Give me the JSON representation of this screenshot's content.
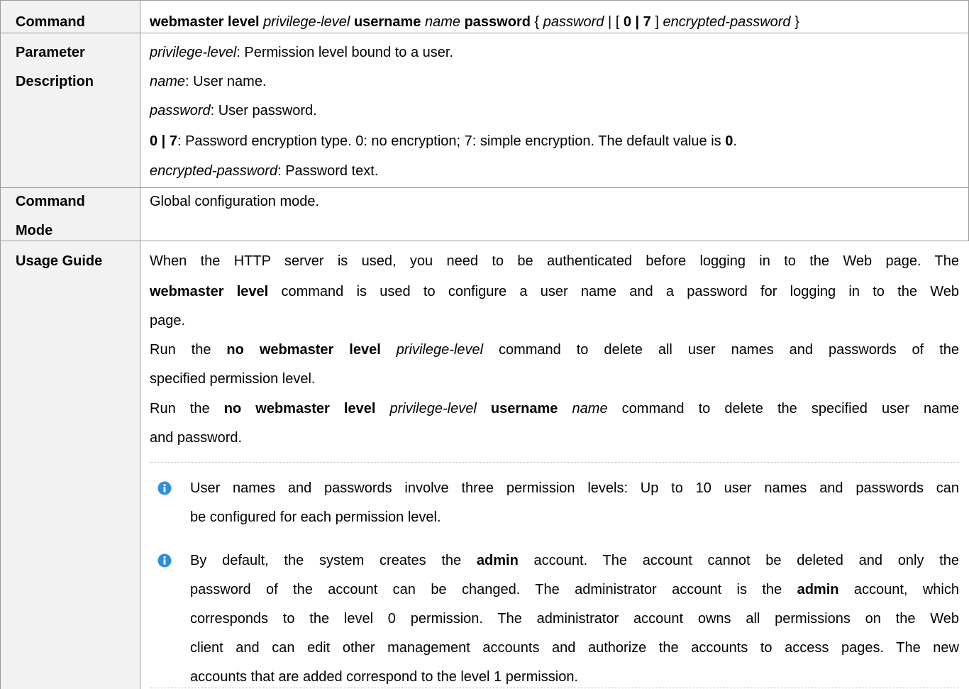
{
  "labels": {
    "command": "Command",
    "param_1": "Parameter",
    "param_2": "Description",
    "mode_1": "Command",
    "mode_2": "Mode",
    "usage": "Usage Guide"
  },
  "command_syntax": {
    "kw1": "webmaster level",
    "a1": "privilege-level",
    "kw2": "username",
    "a2": "name",
    "kw3": "password",
    "p1": "{",
    "a3": "password",
    "p2": "| [",
    "kw4": "0 | 7",
    "p3": "]",
    "a4": "encrypted-password",
    "p4": "}"
  },
  "params": {
    "p1_name": "privilege-level",
    "p1_desc": ": Permission level bound to a user.",
    "p2_name": "name",
    "p2_desc": ": User name.",
    "p3_name": "password",
    "p3_desc": ": User password.",
    "p4_name": "0 | 7",
    "p4_desc": ": Password encryption type. 0: no encryption; 7: simple encryption. The default value is ",
    "p4_default": "0",
    "p4_end": ".",
    "p5_name": "encrypted-password",
    "p5_desc": ": Password text."
  },
  "mode_text": "Global configuration mode.",
  "usage": {
    "l1": "When the HTTP server is used, you need to be authenticated before logging in to the Web page. The",
    "l2_kw": "webmaster level",
    "l2_rest": " command is used to configure a user name and a password for logging in to the Web",
    "l3": "page.",
    "l4_a": "Run the ",
    "l4_kw": "no webmaster level",
    "l4_arg": "privilege-level",
    "l4_rest": " command to delete all user names and passwords of the",
    "l5": "specified permission level.",
    "l6_a": "Run the ",
    "l6_kw": "no webmaster level",
    "l6_arg": "privilege-level",
    "l6_kw2": "username",
    "l6_arg2": "name",
    "l6_rest": " command to delete the specified user name",
    "l7": "and password."
  },
  "notes": {
    "n1_l1": "User names and passwords involve three permission levels: Up to 10 user names and passwords can",
    "n1_l2": "be configured for each permission level.",
    "n2_l1_a": "By default, the system creates the ",
    "n2_l1_kw": "admin",
    "n2_l1_b": " account. The account cannot be deleted and only the",
    "n2_l2_a": "password of the account can be changed. The administrator account is the ",
    "n2_l2_kw": "admin",
    "n2_l2_b": " account, which",
    "n2_l3": "corresponds to the level 0 permission. The administrator account owns all permissions on the Web",
    "n2_l4": "client and can edit other management accounts and authorize the accounts to access pages. The new",
    "n2_l5": "accounts that are added correspond to the level 1 permission."
  },
  "colors": {
    "label_bg": "#f2f2f2",
    "border": "#9a9a9a",
    "info_icon": "#2f8fd8"
  },
  "icons": {
    "note": "info-icon"
  }
}
